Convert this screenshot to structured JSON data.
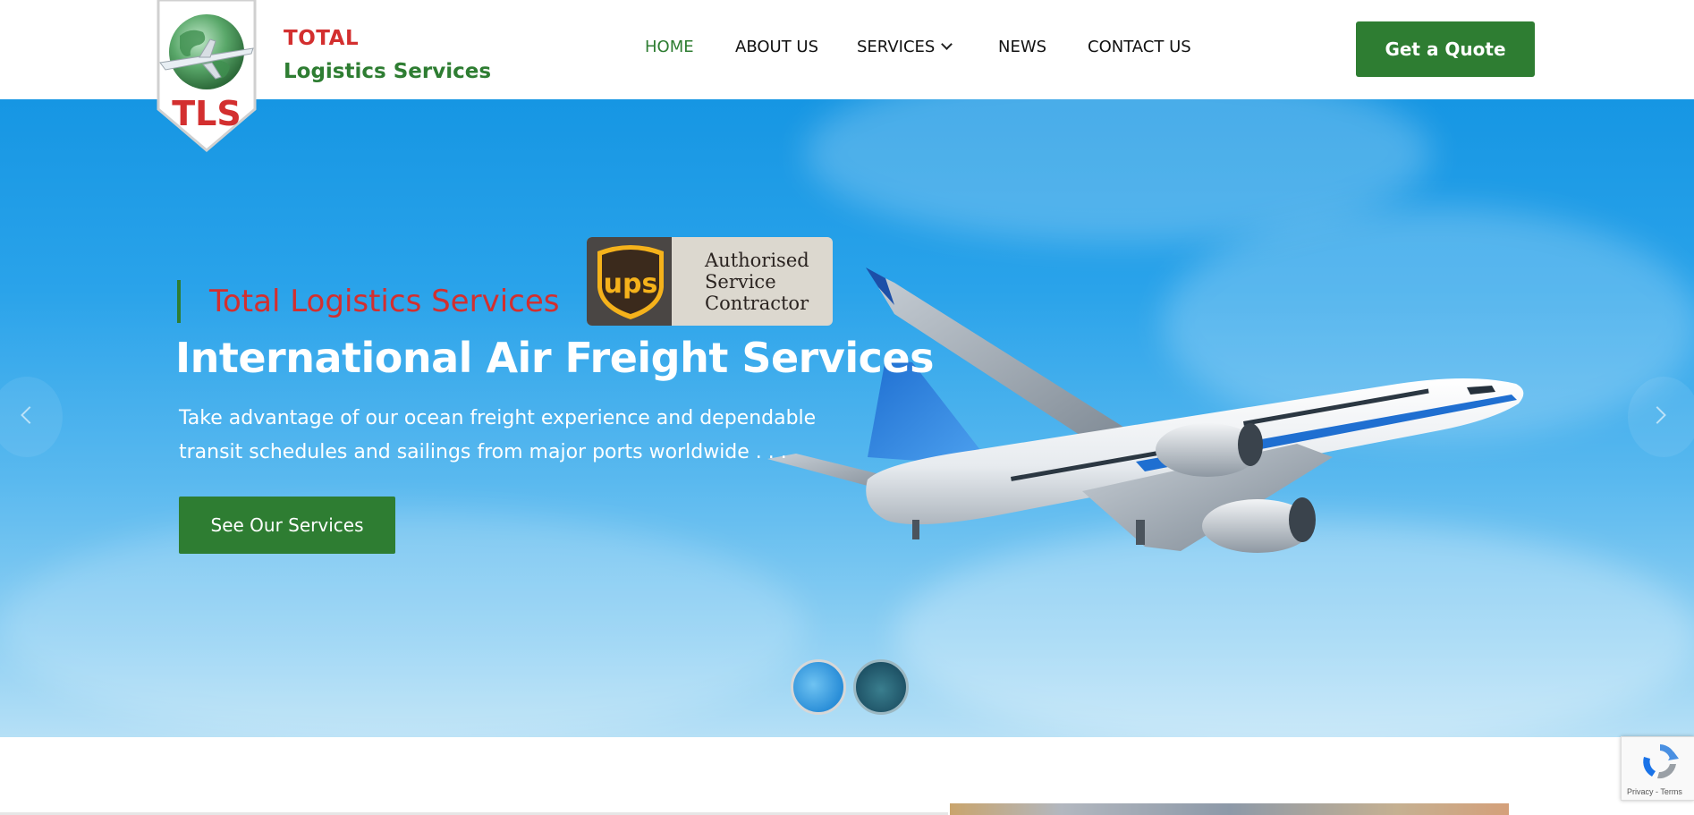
{
  "brand": {
    "badge_text": "TLS",
    "name_line1": "TOTAL",
    "name_line2": "Logistics Services"
  },
  "nav": {
    "items": [
      {
        "label": "HOME",
        "active": true
      },
      {
        "label": "ABOUT US",
        "active": false
      },
      {
        "label": "SERVICES",
        "active": false,
        "has_dropdown": true
      },
      {
        "label": "NEWS",
        "active": false
      },
      {
        "label": "CONTACT US",
        "active": false
      }
    ],
    "quote_button": "Get a Quote"
  },
  "hero": {
    "subtitle": "Total Logistics Services",
    "ups_badge": {
      "logo_text": "ups",
      "line1": "Authorised",
      "line2": "Service",
      "line3": "Contractor"
    },
    "title": "International Air Freight Services",
    "description_line1": "Take advantage of our ocean freight experience and dependable",
    "description_line2": "transit schedules and sailings from major ports worldwide . . .",
    "cta_button": "See Our Services",
    "slide_count": 2,
    "active_slide": 1,
    "prev_icon": "chevron-left-icon",
    "next_icon": "chevron-right-icon"
  },
  "recaptcha": {
    "links": "Privacy - Terms"
  },
  "colors": {
    "brand_green": "#2e7d32",
    "brand_red": "#d32f2f",
    "sky_blue": "#1696e3",
    "white": "#ffffff"
  }
}
